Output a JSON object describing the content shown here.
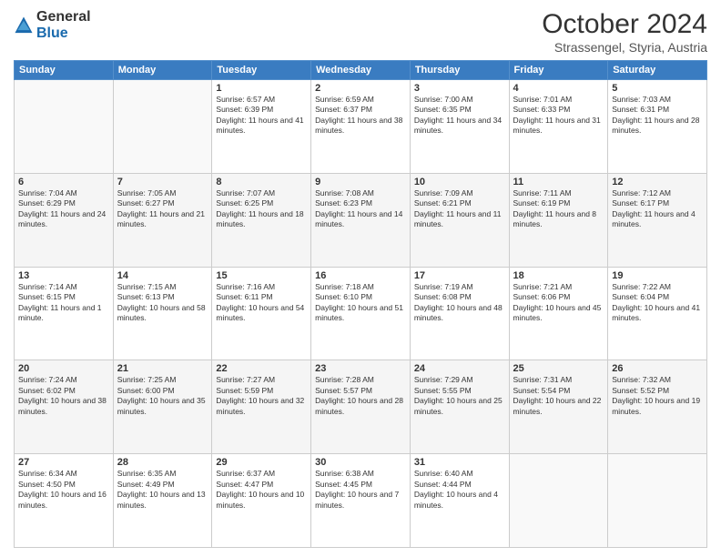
{
  "logo": {
    "general": "General",
    "blue": "Blue"
  },
  "header": {
    "month": "October 2024",
    "location": "Strassengel, Styria, Austria"
  },
  "weekdays": [
    "Sunday",
    "Monday",
    "Tuesday",
    "Wednesday",
    "Thursday",
    "Friday",
    "Saturday"
  ],
  "weeks": [
    [
      {
        "day": "",
        "info": ""
      },
      {
        "day": "",
        "info": ""
      },
      {
        "day": "1",
        "info": "Sunrise: 6:57 AM\nSunset: 6:39 PM\nDaylight: 11 hours and 41 minutes."
      },
      {
        "day": "2",
        "info": "Sunrise: 6:59 AM\nSunset: 6:37 PM\nDaylight: 11 hours and 38 minutes."
      },
      {
        "day": "3",
        "info": "Sunrise: 7:00 AM\nSunset: 6:35 PM\nDaylight: 11 hours and 34 minutes."
      },
      {
        "day": "4",
        "info": "Sunrise: 7:01 AM\nSunset: 6:33 PM\nDaylight: 11 hours and 31 minutes."
      },
      {
        "day": "5",
        "info": "Sunrise: 7:03 AM\nSunset: 6:31 PM\nDaylight: 11 hours and 28 minutes."
      }
    ],
    [
      {
        "day": "6",
        "info": "Sunrise: 7:04 AM\nSunset: 6:29 PM\nDaylight: 11 hours and 24 minutes."
      },
      {
        "day": "7",
        "info": "Sunrise: 7:05 AM\nSunset: 6:27 PM\nDaylight: 11 hours and 21 minutes."
      },
      {
        "day": "8",
        "info": "Sunrise: 7:07 AM\nSunset: 6:25 PM\nDaylight: 11 hours and 18 minutes."
      },
      {
        "day": "9",
        "info": "Sunrise: 7:08 AM\nSunset: 6:23 PM\nDaylight: 11 hours and 14 minutes."
      },
      {
        "day": "10",
        "info": "Sunrise: 7:09 AM\nSunset: 6:21 PM\nDaylight: 11 hours and 11 minutes."
      },
      {
        "day": "11",
        "info": "Sunrise: 7:11 AM\nSunset: 6:19 PM\nDaylight: 11 hours and 8 minutes."
      },
      {
        "day": "12",
        "info": "Sunrise: 7:12 AM\nSunset: 6:17 PM\nDaylight: 11 hours and 4 minutes."
      }
    ],
    [
      {
        "day": "13",
        "info": "Sunrise: 7:14 AM\nSunset: 6:15 PM\nDaylight: 11 hours and 1 minute."
      },
      {
        "day": "14",
        "info": "Sunrise: 7:15 AM\nSunset: 6:13 PM\nDaylight: 10 hours and 58 minutes."
      },
      {
        "day": "15",
        "info": "Sunrise: 7:16 AM\nSunset: 6:11 PM\nDaylight: 10 hours and 54 minutes."
      },
      {
        "day": "16",
        "info": "Sunrise: 7:18 AM\nSunset: 6:10 PM\nDaylight: 10 hours and 51 minutes."
      },
      {
        "day": "17",
        "info": "Sunrise: 7:19 AM\nSunset: 6:08 PM\nDaylight: 10 hours and 48 minutes."
      },
      {
        "day": "18",
        "info": "Sunrise: 7:21 AM\nSunset: 6:06 PM\nDaylight: 10 hours and 45 minutes."
      },
      {
        "day": "19",
        "info": "Sunrise: 7:22 AM\nSunset: 6:04 PM\nDaylight: 10 hours and 41 minutes."
      }
    ],
    [
      {
        "day": "20",
        "info": "Sunrise: 7:24 AM\nSunset: 6:02 PM\nDaylight: 10 hours and 38 minutes."
      },
      {
        "day": "21",
        "info": "Sunrise: 7:25 AM\nSunset: 6:00 PM\nDaylight: 10 hours and 35 minutes."
      },
      {
        "day": "22",
        "info": "Sunrise: 7:27 AM\nSunset: 5:59 PM\nDaylight: 10 hours and 32 minutes."
      },
      {
        "day": "23",
        "info": "Sunrise: 7:28 AM\nSunset: 5:57 PM\nDaylight: 10 hours and 28 minutes."
      },
      {
        "day": "24",
        "info": "Sunrise: 7:29 AM\nSunset: 5:55 PM\nDaylight: 10 hours and 25 minutes."
      },
      {
        "day": "25",
        "info": "Sunrise: 7:31 AM\nSunset: 5:54 PM\nDaylight: 10 hours and 22 minutes."
      },
      {
        "day": "26",
        "info": "Sunrise: 7:32 AM\nSunset: 5:52 PM\nDaylight: 10 hours and 19 minutes."
      }
    ],
    [
      {
        "day": "27",
        "info": "Sunrise: 6:34 AM\nSunset: 4:50 PM\nDaylight: 10 hours and 16 minutes."
      },
      {
        "day": "28",
        "info": "Sunrise: 6:35 AM\nSunset: 4:49 PM\nDaylight: 10 hours and 13 minutes."
      },
      {
        "day": "29",
        "info": "Sunrise: 6:37 AM\nSunset: 4:47 PM\nDaylight: 10 hours and 10 minutes."
      },
      {
        "day": "30",
        "info": "Sunrise: 6:38 AM\nSunset: 4:45 PM\nDaylight: 10 hours and 7 minutes."
      },
      {
        "day": "31",
        "info": "Sunrise: 6:40 AM\nSunset: 4:44 PM\nDaylight: 10 hours and 4 minutes."
      },
      {
        "day": "",
        "info": ""
      },
      {
        "day": "",
        "info": ""
      }
    ]
  ]
}
